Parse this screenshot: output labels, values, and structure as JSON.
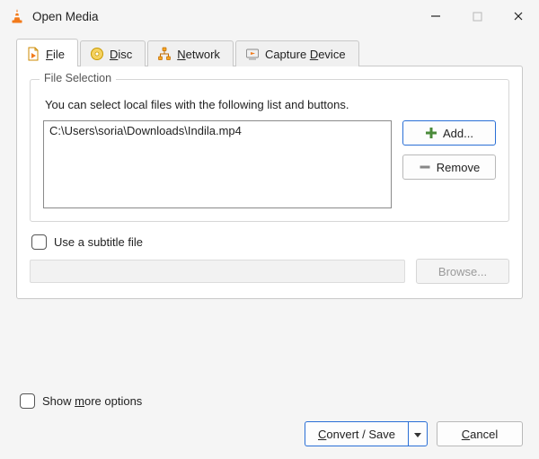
{
  "window": {
    "title": "Open Media"
  },
  "tabs": {
    "file": {
      "label_pre": "",
      "accel": "F",
      "label_post": "ile"
    },
    "disc": {
      "label_pre": "",
      "accel": "D",
      "label_post": "isc"
    },
    "network": {
      "label_pre": "",
      "accel": "N",
      "label_post": "etwork"
    },
    "capture": {
      "label_pre": "Capture ",
      "accel": "D",
      "label_post": "evice"
    }
  },
  "file_selection": {
    "legend": "File Selection",
    "hint": "You can select local files with the following list and buttons.",
    "files": [
      "C:\\Users\\soria\\Downloads\\Indila.mp4"
    ],
    "add_label": "Add...",
    "remove_label": "Remove"
  },
  "subtitle": {
    "checkbox_label": "Use a subtitle file",
    "browse_label": "Browse..."
  },
  "more_options": {
    "label_pre": "Show ",
    "accel": "m",
    "label_post": "ore options"
  },
  "actions": {
    "convert_pre": "",
    "convert_accel": "C",
    "convert_post": "onvert / Save",
    "cancel_pre": "",
    "cancel_accel": "C",
    "cancel_post": "ancel"
  }
}
